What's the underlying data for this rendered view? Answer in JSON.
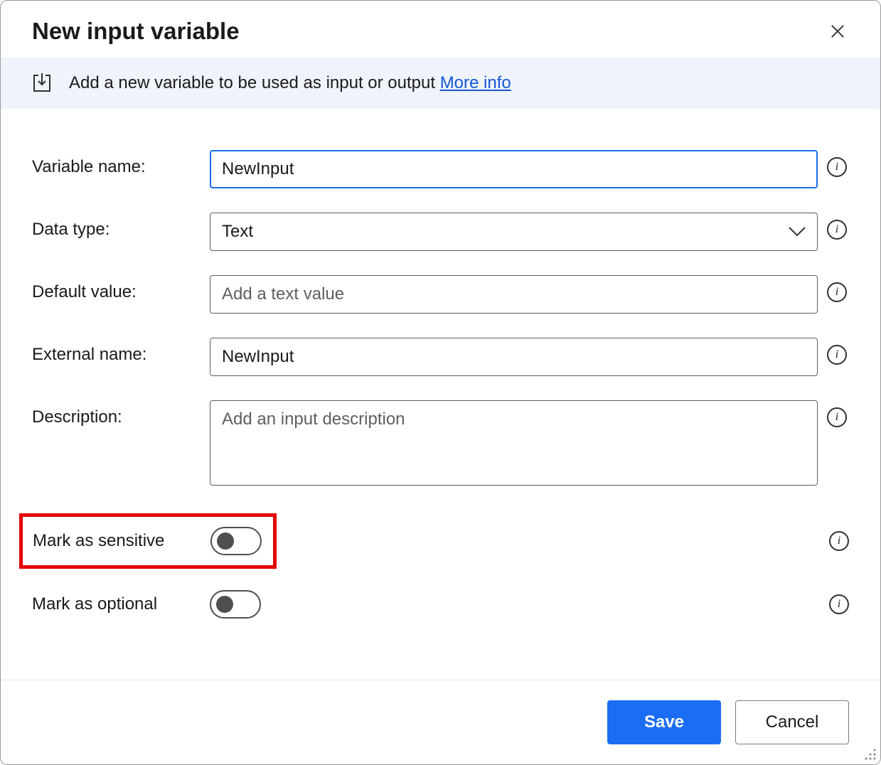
{
  "dialog": {
    "title": "New input variable",
    "save_label": "Save",
    "cancel_label": "Cancel"
  },
  "info_bar": {
    "text": "Add a new variable to be used as input or output ",
    "link": "More info"
  },
  "form": {
    "variable_name": {
      "label": "Variable name:",
      "value": "NewInput"
    },
    "data_type": {
      "label": "Data type:",
      "value": "Text"
    },
    "default_value": {
      "label": "Default value:",
      "placeholder": "Add a text value",
      "value": ""
    },
    "external_name": {
      "label": "External name:",
      "value": "NewInput"
    },
    "description": {
      "label": "Description:",
      "placeholder": "Add an input description",
      "value": ""
    },
    "mark_sensitive": {
      "label": "Mark as sensitive",
      "checked": false
    },
    "mark_optional": {
      "label": "Mark as optional",
      "checked": false
    }
  },
  "info_tooltip_glyph": "i"
}
